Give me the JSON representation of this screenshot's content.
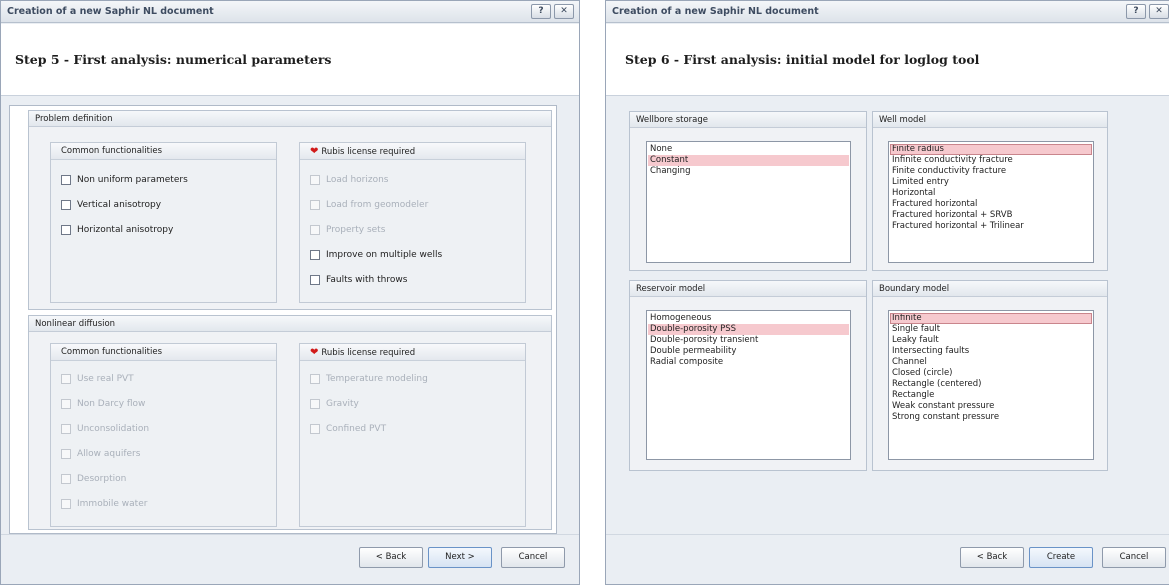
{
  "dialog_left": {
    "title": "Creation of a new Saphir NL document",
    "help_btn": "?",
    "close_btn": "✕",
    "step_title": "Step 5 - First analysis: numerical parameters",
    "problem_definition": {
      "title": "Problem definition",
      "common": {
        "title": "Common functionalities",
        "items": [
          "Non uniform parameters",
          "Vertical anisotropy",
          "Horizontal anisotropy"
        ]
      },
      "rubis": {
        "title": "Rubis license required",
        "items": [
          "Load horizons",
          "Load from geomodeler",
          "Property sets",
          "Improve on multiple wells",
          "Faults with throws"
        ]
      }
    },
    "nonlinear_diffusion": {
      "title": "Nonlinear diffusion",
      "common": {
        "title": "Common functionalities",
        "items": [
          "Use real PVT",
          "Non Darcy flow",
          "Unconsolidation",
          "Allow aquifers",
          "Desorption",
          "Immobile water"
        ]
      },
      "rubis": {
        "title": "Rubis license required",
        "items": [
          "Temperature modeling",
          "Gravity",
          "Confined PVT"
        ]
      }
    },
    "buttons": {
      "back": "< Back",
      "next": "Next >",
      "cancel": "Cancel"
    }
  },
  "dialog_right": {
    "title": "Creation of a new Saphir NL document",
    "help_btn": "?",
    "close_btn": "✕",
    "step_title": "Step 6 - First analysis: initial model for loglog tool",
    "wellbore_storage": {
      "title": "Wellbore storage",
      "items": [
        "None",
        "Constant",
        "Changing"
      ],
      "selected": "Constant"
    },
    "well_model": {
      "title": "Well model",
      "items": [
        "Finite radius",
        "Infinite conductivity fracture",
        "Finite conductivity fracture",
        "Limited entry",
        "Horizontal",
        "Fractured horizontal",
        "Fractured horizontal + SRVB",
        "Fractured horizontal + Trilinear"
      ],
      "selected": "Finite radius"
    },
    "reservoir_model": {
      "title": "Reservoir model",
      "items": [
        "Homogeneous",
        "Double-porosity PSS",
        "Double-porosity transient",
        "Double permeability",
        "Radial composite"
      ],
      "selected": "Double-porosity PSS"
    },
    "boundary_model": {
      "title": "Boundary model",
      "items": [
        "Infinite",
        "Single fault",
        "Leaky fault",
        "Intersecting faults",
        "Channel",
        "Closed (circle)",
        "Rectangle (centered)",
        "Rectangle",
        "Weak constant pressure",
        "Strong constant pressure"
      ],
      "selected": "Infinite"
    },
    "buttons": {
      "back": "< Back",
      "create": "Create",
      "cancel": "Cancel"
    }
  },
  "colors": {
    "selection": "#f6c9ce",
    "heart": "#d11a1a",
    "dialog_bg": "#eaeef3"
  }
}
